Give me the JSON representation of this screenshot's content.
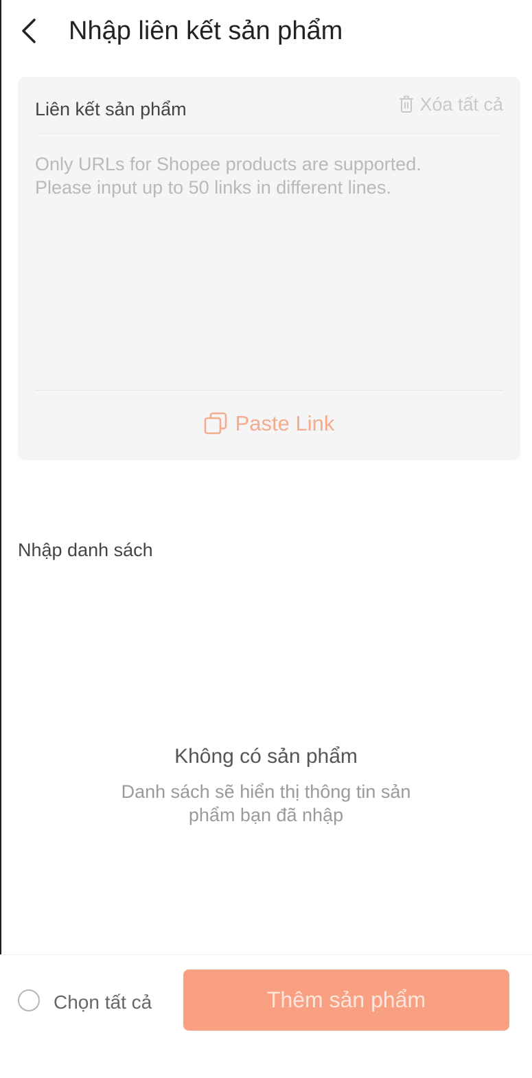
{
  "header": {
    "title": "Nhập liên kết sản phẩm",
    "back_icon": "chevron-left-icon"
  },
  "link_card": {
    "label": "Liên kết sản phẩm",
    "clear_all_label": "Xóa tất cả",
    "clear_all_icon": "trash-icon",
    "input_value": "",
    "placeholder": "Only URLs for Shopee products are supported.\nPlease input up to 50 links in different lines.",
    "paste_label": "Paste Link",
    "paste_icon": "copy-icon",
    "accent_color": "#f5ab8e"
  },
  "import_list": {
    "title": "Nhập danh sách",
    "empty_title": "Không có sản phẩm",
    "empty_description": "Danh sách sẽ hiển thị thông tin sản phẩm bạn đã nhập"
  },
  "footer": {
    "select_all_label": "Chọn tất cả",
    "select_all_checked": false,
    "add_button_label": "Thêm sản phẩm",
    "add_button_color": "#f9a083"
  }
}
